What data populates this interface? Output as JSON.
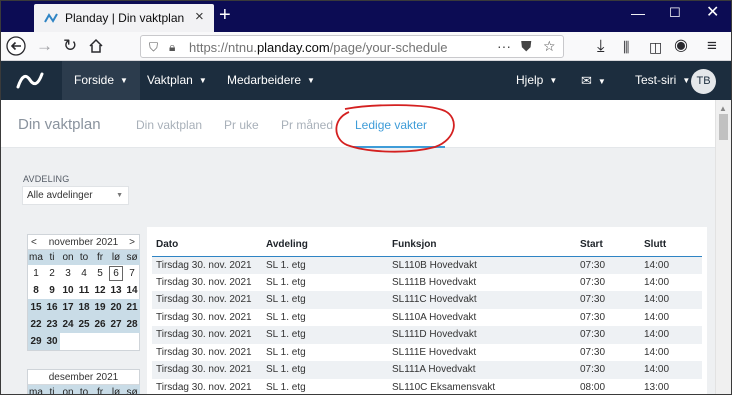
{
  "browser": {
    "tab_title": "Planday | Din vaktplan",
    "url_prefix": "https://ntnu.",
    "url_domain": "planday.com",
    "url_path": "/page/your-schedule"
  },
  "app": {
    "menu": [
      "Forside",
      "Vaktplan",
      "Medarbeidere"
    ],
    "help_label": "Hjelp",
    "user_name": "Test-siri",
    "avatar_initials": "TB",
    "brand_color": "#1c2d3e"
  },
  "subnav": {
    "title": "Din vaktplan",
    "tabs": [
      "Din vaktplan",
      "Pr uke",
      "Pr måned",
      "Ledige vakter"
    ],
    "active_tab": "Ledige vakter"
  },
  "filter": {
    "label": "AVDELING",
    "value": "Alle avdelinger"
  },
  "calendar": {
    "prev": "<",
    "next": ">",
    "weekdays": [
      "ma",
      "ti",
      "on",
      "to",
      "fr",
      "lø",
      "sø"
    ],
    "months": [
      {
        "name": "november 2021",
        "weeks": [
          [
            "1",
            "2",
            "3",
            "4",
            "5",
            "6",
            "7"
          ],
          [
            "8",
            "9",
            "10",
            "11",
            "12",
            "13",
            "14"
          ],
          [
            "15",
            "16",
            "17",
            "18",
            "19",
            "20",
            "21"
          ],
          [
            "22",
            "23",
            "24",
            "25",
            "26",
            "27",
            "28"
          ],
          [
            "29",
            "30",
            "",
            "",
            "",
            "",
            ""
          ]
        ]
      },
      {
        "name": "desember 2021",
        "weeks": []
      }
    ]
  },
  "shifts": {
    "columns": [
      "Dato",
      "Avdeling",
      "Funksjon",
      "Start",
      "Slutt"
    ],
    "rows": [
      [
        "Tirsdag 30. nov. 2021",
        "SL 1. etg",
        "SL110B Hovedvakt",
        "07:30",
        "14:00"
      ],
      [
        "Tirsdag 30. nov. 2021",
        "SL 1. etg",
        "SL111B Hovedvakt",
        "07:30",
        "14:00"
      ],
      [
        "Tirsdag 30. nov. 2021",
        "SL 1. etg",
        "SL111C Hovedvakt",
        "07:30",
        "14:00"
      ],
      [
        "Tirsdag 30. nov. 2021",
        "SL 1. etg",
        "SL110A Hovedvakt",
        "07:30",
        "14:00"
      ],
      [
        "Tirsdag 30. nov. 2021",
        "SL 1. etg",
        "SL111D Hovedvakt",
        "07:30",
        "14:00"
      ],
      [
        "Tirsdag 30. nov. 2021",
        "SL 1. etg",
        "SL111E Hovedvakt",
        "07:30",
        "14:00"
      ],
      [
        "Tirsdag 30. nov. 2021",
        "SL 1. etg",
        "SL111A Hovedvakt",
        "07:30",
        "14:00"
      ],
      [
        "Tirsdag 30. nov. 2021",
        "SL 1. etg",
        "SL110C Eksamensvakt",
        "08:00",
        "13:00"
      ]
    ]
  }
}
